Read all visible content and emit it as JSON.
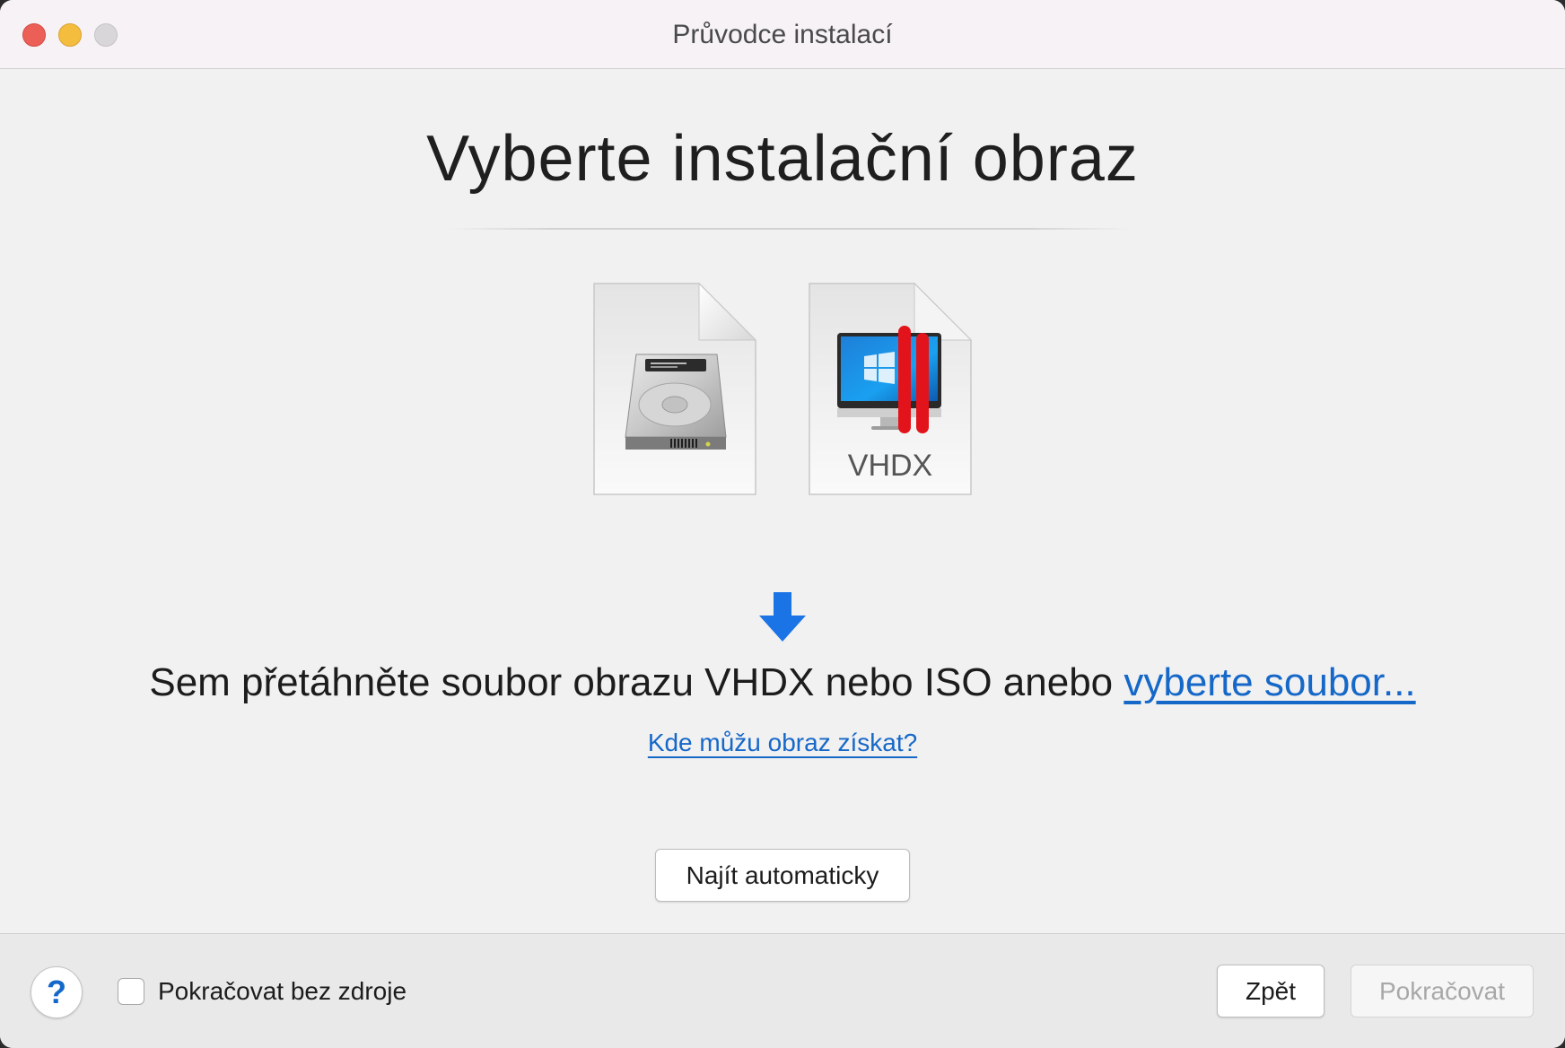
{
  "window": {
    "title": "Průvodce instalací"
  },
  "main": {
    "heading": "Vyberte instalační obraz",
    "icons": {
      "hdd": "hard-disk-icon",
      "vhdx_label": "VHDX"
    },
    "drag_text": "Sem přetáhněte soubor obrazu VHDX nebo ISO anebo ",
    "choose_file_link": "vyberte soubor...",
    "where_link": "Kde můžu obraz získat?",
    "find_button": "Najít automaticky"
  },
  "footer": {
    "help_label": "?",
    "checkbox_label": "Pokračovat bez zdroje",
    "checkbox_checked": false,
    "back_button": "Zpět",
    "continue_button": "Pokračovat"
  },
  "colors": {
    "link": "#1668c8",
    "arrow": "#1a74e6",
    "parallels_red": "#e3131b"
  }
}
